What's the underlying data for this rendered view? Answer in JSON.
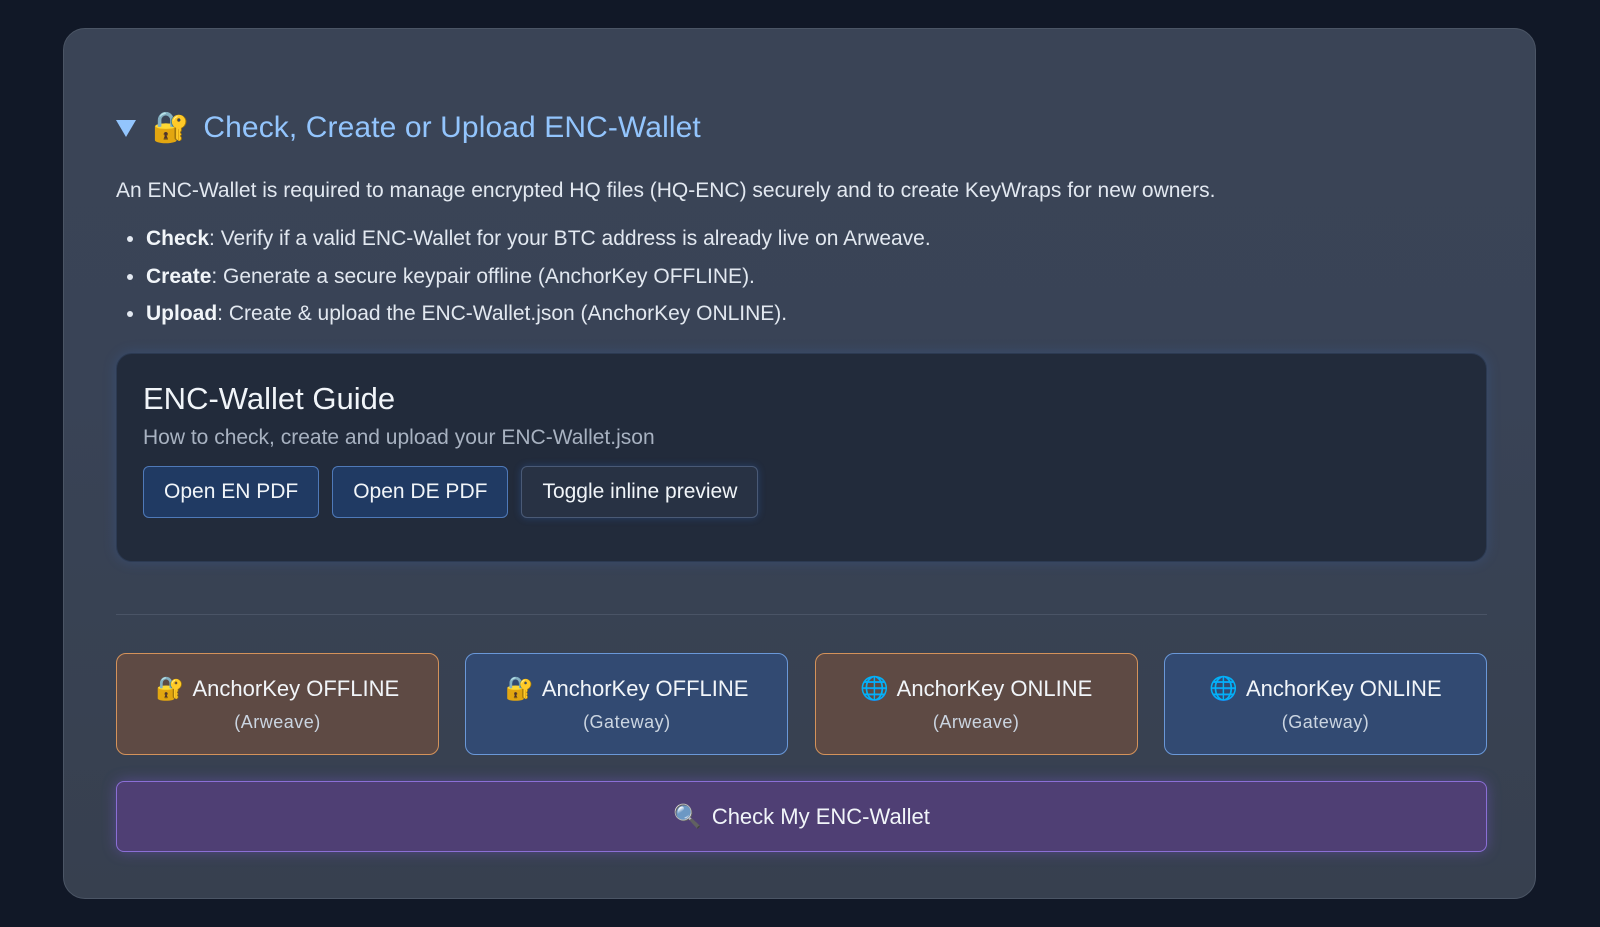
{
  "section": {
    "lock_emoji": "🔐",
    "title": "Check, Create or Upload ENC-Wallet",
    "intro": "An ENC-Wallet is required to manage encrypted HQ files (HQ-ENC) securely and to create KeyWraps for new owners.",
    "bullets": [
      {
        "term": "Check",
        "text": ": Verify if a valid ENC-Wallet for your BTC address is already live on Arweave."
      },
      {
        "term": "Create",
        "text": ": Generate a secure keypair offline (AnchorKey OFFLINE)."
      },
      {
        "term": "Upload",
        "text": ": Create & upload the ENC-Wallet.json (AnchorKey ONLINE)."
      }
    ]
  },
  "guide": {
    "title": "ENC-Wallet Guide",
    "subtitle": "How to check, create and upload your ENC-Wallet.json",
    "buttons": {
      "en_pdf": "Open EN PDF",
      "de_pdf": "Open DE PDF",
      "toggle": "Toggle inline preview"
    }
  },
  "anchorkey": [
    {
      "emoji": "🔐",
      "label": "AnchorKey OFFLINE",
      "sub": "(Arweave)",
      "color": "#d4925a"
    },
    {
      "emoji": "🔐",
      "label": "AnchorKey OFFLINE",
      "sub": "(Gateway)",
      "color": "#6a98d8"
    },
    {
      "emoji": "🌐",
      "label": "AnchorKey ONLINE",
      "sub": "(Arweave)",
      "color": "#d4925a"
    },
    {
      "emoji": "🌐",
      "label": "AnchorKey ONLINE",
      "sub": "(Gateway)",
      "color": "#6a98d8"
    }
  ],
  "check_button": {
    "emoji": "🔍",
    "label": "Check My ENC-Wallet"
  },
  "colors": {
    "accent_title": "#93c5fd",
    "check_button": "#8b6fd6"
  }
}
